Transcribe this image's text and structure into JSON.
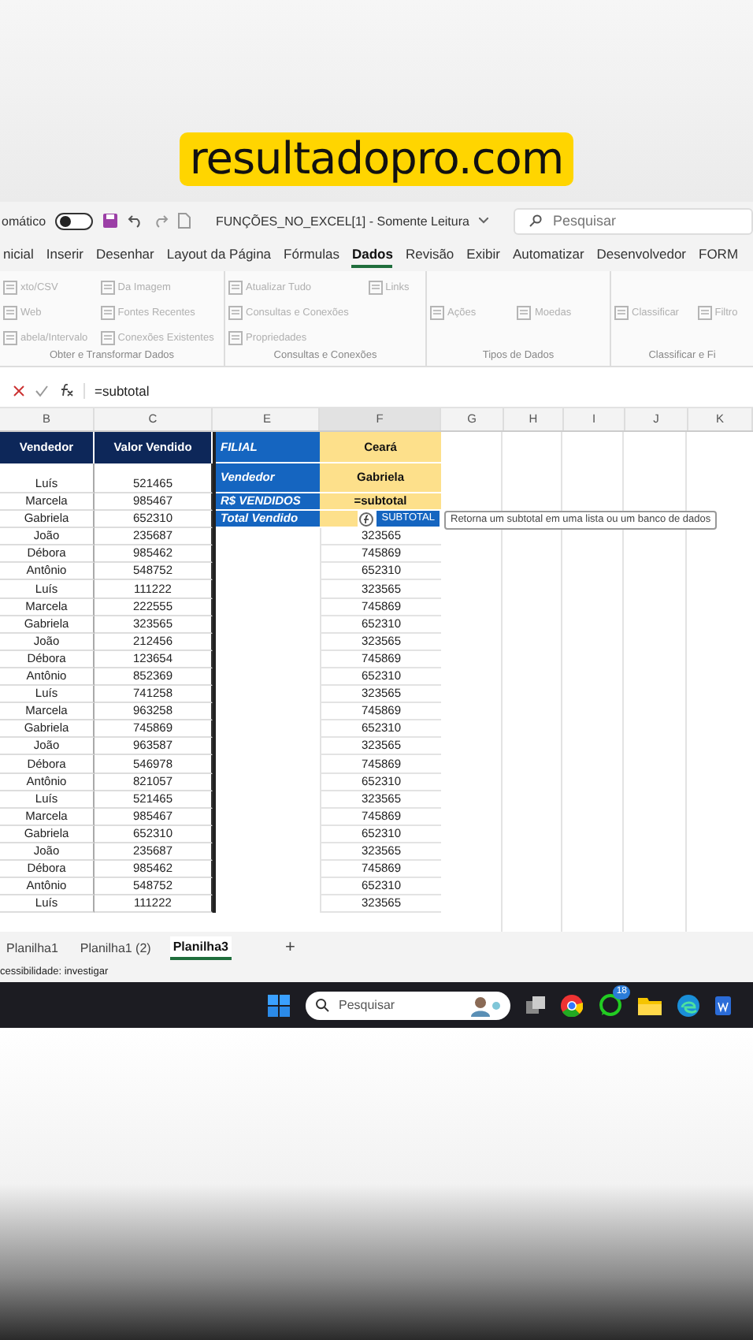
{
  "caption": "resultadopro.com",
  "titlebar": {
    "autosave_label": "omático",
    "autosave_on": false,
    "document": "FUNÇÕES_NO_EXCEL[1]  -  Somente Leitura",
    "search_placeholder": "Pesquisar"
  },
  "menu": [
    {
      "label": "nicial",
      "selected": false
    },
    {
      "label": "Inserir",
      "selected": false
    },
    {
      "label": "Desenhar",
      "selected": false
    },
    {
      "label": "Layout da Página",
      "selected": false
    },
    {
      "label": "Fórmulas",
      "selected": false
    },
    {
      "label": "Dados",
      "selected": true
    },
    {
      "label": "Revisão",
      "selected": false
    },
    {
      "label": "Exibir",
      "selected": false
    },
    {
      "label": "Automatizar",
      "selected": false
    },
    {
      "label": "Desenvolvedor",
      "selected": false
    },
    {
      "label": "FORM",
      "selected": false
    }
  ],
  "ribbon": [
    {
      "label": "Obter e Transformar Dados",
      "items": [
        "xto/CSV",
        "Web",
        "abela/Intervalo",
        "Da Imagem",
        "Fontes Recentes",
        "Conexões Existentes"
      ]
    },
    {
      "label": "Consultas e Conexões",
      "items": [
        "Atualizar Tudo",
        "Consultas e Conexões",
        "Propriedades",
        "Links"
      ]
    },
    {
      "label": "Tipos de Dados",
      "items": [
        "Ações",
        "Moedas"
      ]
    },
    {
      "label": "Classificar e Fi",
      "items": [
        "Classificar",
        "Filtro"
      ]
    }
  ],
  "formula_bar": {
    "value": "=subtotal"
  },
  "columns": [
    "B",
    "C",
    "E",
    "F",
    "G",
    "H",
    "I",
    "J",
    "K"
  ],
  "sheet": {
    "header": {
      "b": "Vendedor",
      "c": "Valor Vendido",
      "e": "FILIAL",
      "f": "Ceará"
    },
    "rows": [
      {
        "kind": "field",
        "b": "Luís",
        "c": "521465",
        "e": "Vendedor",
        "f": "Gabriela"
      },
      {
        "kind": "field",
        "b": "Marcela",
        "c": "985467",
        "e": "R$ VENDIDOS",
        "f": "=subtotal"
      },
      {
        "kind": "field",
        "b": "Gabriela",
        "c": "652310",
        "e": "Total Vendido"
      },
      {
        "kind": "plain",
        "b": "João",
        "c": "235687",
        "f": "323565"
      },
      {
        "kind": "plain",
        "b": "Débora",
        "c": "985462",
        "f": "745869"
      },
      {
        "kind": "plain",
        "b": "Antônio",
        "c": "548752",
        "f": "652310"
      },
      {
        "kind": "plain",
        "b": "Luís",
        "c": "111222",
        "f": "323565"
      },
      {
        "kind": "plain",
        "b": "Marcela",
        "c": "222555",
        "f": "745869"
      },
      {
        "kind": "plain",
        "b": "Gabriela",
        "c": "323565",
        "f": "652310"
      },
      {
        "kind": "plain",
        "b": "João",
        "c": "212456",
        "f": "323565"
      },
      {
        "kind": "plain",
        "b": "Débora",
        "c": "123654",
        "f": "745869"
      },
      {
        "kind": "plain",
        "b": "Antônio",
        "c": "852369",
        "f": "652310"
      },
      {
        "kind": "plain",
        "b": "Luís",
        "c": "741258",
        "f": "323565"
      },
      {
        "kind": "plain",
        "b": "Marcela",
        "c": "963258",
        "f": "745869"
      },
      {
        "kind": "plain",
        "b": "Gabriela",
        "c": "745869",
        "f": "652310"
      },
      {
        "kind": "plain",
        "b": "João",
        "c": "963587",
        "f": "323565"
      },
      {
        "kind": "plain",
        "b": "Débora",
        "c": "546978",
        "f": "745869"
      },
      {
        "kind": "plain",
        "b": "Antônio",
        "c": "821057",
        "f": "652310"
      },
      {
        "kind": "plain",
        "b": "Luís",
        "c": "521465",
        "f": "323565"
      },
      {
        "kind": "plain",
        "b": "Marcela",
        "c": "985467",
        "f": "745869"
      },
      {
        "kind": "plain",
        "b": "Gabriela",
        "c": "652310",
        "f": "652310"
      },
      {
        "kind": "plain",
        "b": "João",
        "c": "235687",
        "f": "323565"
      },
      {
        "kind": "plain",
        "b": "Débora",
        "c": "985462",
        "f": "745869"
      },
      {
        "kind": "plain",
        "b": "Antônio",
        "c": "548752",
        "f": "652310"
      },
      {
        "kind": "plain",
        "b": "Luís",
        "c": "111222",
        "f": "323565"
      }
    ]
  },
  "autocomplete": {
    "item": "SUBTOTAL",
    "tooltip": "Retorna um subtotal em uma lista ou um banco de dados"
  },
  "sheet_tabs": [
    {
      "label": "Planilha1",
      "selected": false
    },
    {
      "label": "Planilha1 (2)",
      "selected": false
    },
    {
      "label": "Planilha3",
      "selected": true
    }
  ],
  "add_sheet": "+",
  "status_bar": "cessibilidade: investigar",
  "taskbar": {
    "search_placeholder": "Pesquisar",
    "whatsapp_badge": "18"
  }
}
